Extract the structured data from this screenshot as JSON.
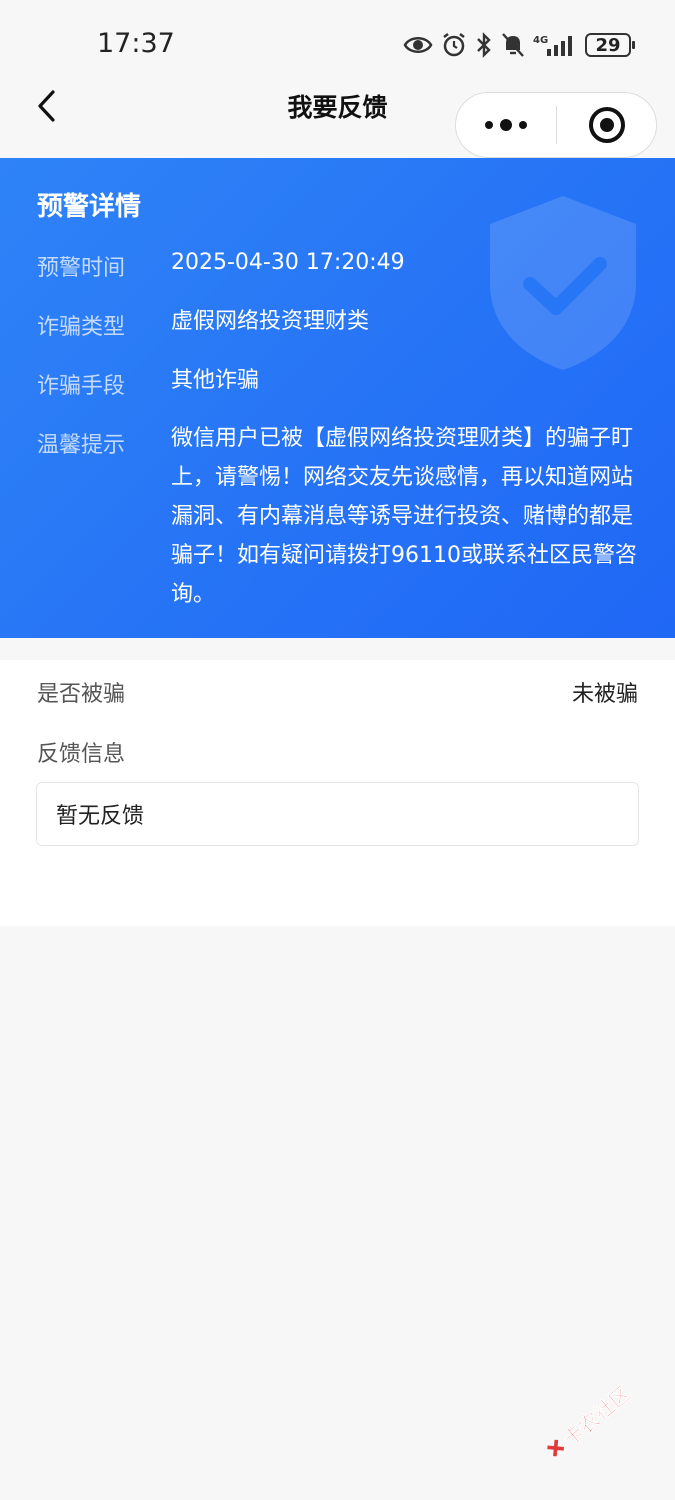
{
  "status_bar": {
    "time": "17:37",
    "battery": "29",
    "network": "4G",
    "icons": [
      "eye-icon",
      "alarm-icon",
      "bluetooth-icon",
      "mute-icon",
      "signal-icon",
      "battery-icon"
    ]
  },
  "nav": {
    "title": "我要反馈",
    "back_icon": "chevron-left-icon",
    "more_icon": "more-dots-icon",
    "close_icon": "target-close-icon"
  },
  "warning": {
    "title": "预警详情",
    "rows": [
      {
        "label": "预警时间",
        "value": "2025-04-30 17:20:49"
      },
      {
        "label": "诈骗类型",
        "value": "虚假网络投资理财类"
      },
      {
        "label": "诈骗手段",
        "value": "其他诈骗"
      },
      {
        "label": "温馨提示",
        "value": "微信用户已被【虚假网络投资理财类】的骗子盯上，请警惕！网络交友先谈感情，再以知道网站漏洞、有内幕消息等诱导进行投资、赌博的都是骗子！如有疑问请拨打96110或联系社区民警咨询。"
      }
    ],
    "watermark_icon": "shield-check-icon",
    "colors": {
      "start": "#2f83f7",
      "end": "#1f67f5"
    }
  },
  "feedback": {
    "scammed_label": "是否被骗",
    "scammed_value": "未被骗",
    "info_label": "反馈信息",
    "info_value": "暂无反馈"
  },
  "watermark": {
    "text": "卡农社区"
  }
}
